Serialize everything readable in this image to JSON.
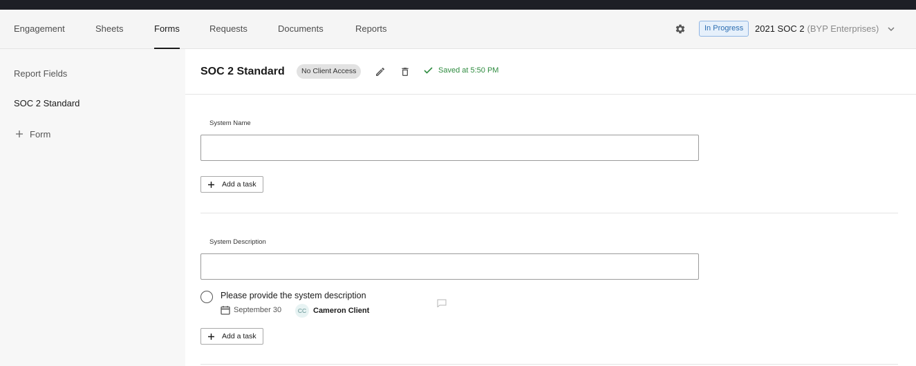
{
  "nav": {
    "tabs": [
      {
        "label": "Engagement",
        "active": false
      },
      {
        "label": "Sheets",
        "active": false
      },
      {
        "label": "Forms",
        "active": true
      },
      {
        "label": "Requests",
        "active": false
      },
      {
        "label": "Documents",
        "active": false
      },
      {
        "label": "Reports",
        "active": false
      }
    ],
    "settings_icon": "gear-icon",
    "status_badge": "In Progress",
    "engagement_name": "2021 SOC 2",
    "engagement_client": "(BYP Enterprises)",
    "dropdown_icon": "chevron-down-icon"
  },
  "sidebar": {
    "title": "Report Fields",
    "items": [
      {
        "label": "SOC 2 Standard"
      }
    ],
    "add_label": "Form"
  },
  "form": {
    "title": "SOC 2 Standard",
    "access_badge": "No Client Access",
    "saved_text": "Saved at 5:50 PM",
    "fields": [
      {
        "label": "System Name",
        "value": "",
        "add_task_label": "Add a task",
        "tasks": []
      },
      {
        "label": "System Description",
        "value": "",
        "add_task_label": "Add a task",
        "tasks": [
          {
            "text": "Please provide the system description",
            "due": "September 30",
            "assignee_initials": "CC",
            "assignee_name": "Cameron Client"
          }
        ]
      }
    ]
  },
  "colors": {
    "top_bar": "#1d1f26",
    "status_blue": "#2b6cb0",
    "saved_green": "#2e8b3f",
    "sidebar_bg": "#f7f7f7"
  }
}
